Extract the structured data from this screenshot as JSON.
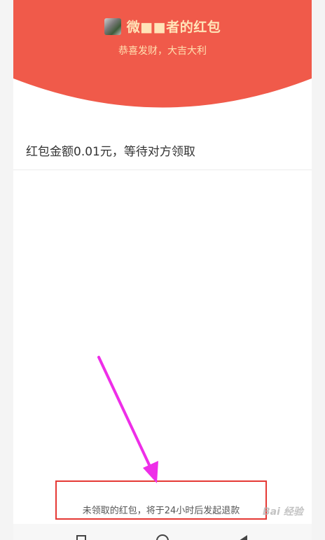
{
  "header": {
    "sender_title": "微■■者的红包",
    "subtitle": "恭喜发财，大吉大利",
    "header_color": "#f05a4a",
    "title_color": "#ffe4b8"
  },
  "detail": {
    "amount_status": "红包金额0.01元，等待对方领取"
  },
  "notice": {
    "text": "未领取的红包，将于24小时后发起退款",
    "box_color": "#e53935"
  },
  "annotation": {
    "arrow_color": "#ee2ee8"
  },
  "watermark": {
    "text": "Bai 经验"
  },
  "navbar": {
    "icons": [
      "back-square-icon",
      "home-circle-icon",
      "recent-triangle-icon"
    ]
  }
}
